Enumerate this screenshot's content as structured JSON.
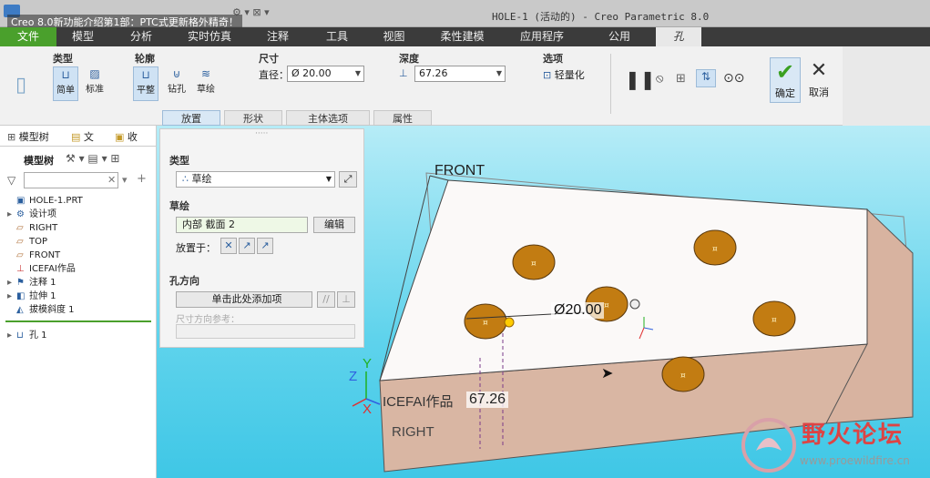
{
  "titlebar": {
    "video_title": "Creo 8.0新功能介绍第1部：PTC式更新格外精奇！",
    "window_title": "HOLE-1 (活动的) - Creo Parametric 8.0"
  },
  "menubar": {
    "items": [
      "文件",
      "模型",
      "分析",
      "实时仿真",
      "注释",
      "工具",
      "视图",
      "柔性建模",
      "应用程序",
      "公用",
      "孔"
    ]
  },
  "ribbon": {
    "group_type": {
      "label": "类型",
      "btn_simple": "简单",
      "btn_standard": "标准"
    },
    "group_profile": {
      "label": "轮廓",
      "btn_flat": "平整",
      "btn_drill": "钻孔",
      "btn_sketch": "草绘"
    },
    "group_size": {
      "label": "尺寸",
      "diameter_label": "直径：",
      "diameter_value": "Ø 20.00"
    },
    "group_depth": {
      "label": "深度",
      "depth_value": "67.26"
    },
    "group_options": {
      "label": "选项",
      "lightweight": "轻量化"
    },
    "ok": "确定",
    "cancel": "取消"
  },
  "subtabs": [
    "放置",
    "形状",
    "主体选项",
    "属性"
  ],
  "left_panel": {
    "tabs": [
      "模型树",
      "文",
      "收"
    ],
    "toolbar_label": "模型树",
    "tree": [
      {
        "label": "HOLE-1.PRT",
        "icon": "part-icon"
      },
      {
        "label": "设计项",
        "icon": "design-items-icon"
      },
      {
        "label": "RIGHT",
        "icon": "datum-plane-icon"
      },
      {
        "label": "TOP",
        "icon": "datum-plane-icon"
      },
      {
        "label": "FRONT",
        "icon": "datum-plane-icon"
      },
      {
        "label": "ICEFAI作品",
        "icon": "csys-icon"
      },
      {
        "label": "注释 1",
        "icon": "annotation-icon"
      },
      {
        "label": "拉伸 1",
        "icon": "extrude-icon"
      },
      {
        "label": "拔模斜度 1",
        "icon": "draft-icon"
      },
      {
        "label": "孔 1",
        "icon": "hole-icon"
      }
    ]
  },
  "placement_panel": {
    "type_label": "类型",
    "type_value": "草绘",
    "sketch_label": "草绘",
    "sketch_value": "内部 截面 2",
    "edit_button": "编辑",
    "place_on_label": "放置于：",
    "hole_dir_label": "孔方向",
    "add_item": "单击此处添加项",
    "dim_ref_label": "尺寸方向参考："
  },
  "viewport": {
    "front_label": "FRONT",
    "right_label": "RIGHT",
    "csys_label": "ICEFAI作品",
    "diameter_dim": "Ø20.00",
    "depth_dim": "67.26",
    "axis_x": "X",
    "axis_y": "Y",
    "axis_z": "Z",
    "colors": {
      "part_top": "#fbf9f8",
      "part_side": "#d8b3a0",
      "hole": "#c27c12"
    }
  },
  "watermark": {
    "title": "野火论坛",
    "url": "www.proewildfire.cn"
  }
}
